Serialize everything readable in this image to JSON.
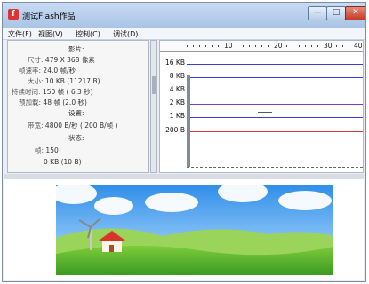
{
  "window": {
    "title": "测试Flash作品",
    "app_icon": "flash-app-icon"
  },
  "controls": {
    "minimize": "—",
    "maximize": "□",
    "close": "✕"
  },
  "menu": [
    "文件(F)",
    "视图(V)",
    "控制(C)",
    "调试(D)"
  ],
  "stats": {
    "movie_heading": "影片:",
    "size_label": "尺寸:",
    "size_value": "479 X 368 像素",
    "framerate_label": "帧速率:",
    "framerate_value": "24.0 帧/秒",
    "filesize_label": "大小:",
    "filesize_value": "10 KB (11217 B)",
    "duration_label": "持续时间:",
    "duration_value": "150 帧 ( 6.3 秒)",
    "preload_label": "预加载:",
    "preload_value": "48 帧 (2.0 秒)",
    "settings_heading": "设置:",
    "bandwidth_label": "带宽:",
    "bandwidth_value": "4800 B/秒 ( 200 B/帧 )",
    "state_heading": "状态:",
    "frame_label": "帧:",
    "frame_value": "150",
    "loaded_value": "0 KB (10 B)"
  },
  "graph": {
    "ruler_ticks": [
      "10",
      "20",
      "30",
      "40"
    ],
    "y_labels": [
      "16 KB",
      "8 KB",
      "4 KB",
      "2 KB",
      "1 KB",
      "200 B"
    ],
    "line_colors": [
      "#3b3bd6",
      "#3b3bd6",
      "#7a3fb8",
      "#7a3fb8",
      "#3b3bd6",
      "#d43a3a"
    ]
  }
}
